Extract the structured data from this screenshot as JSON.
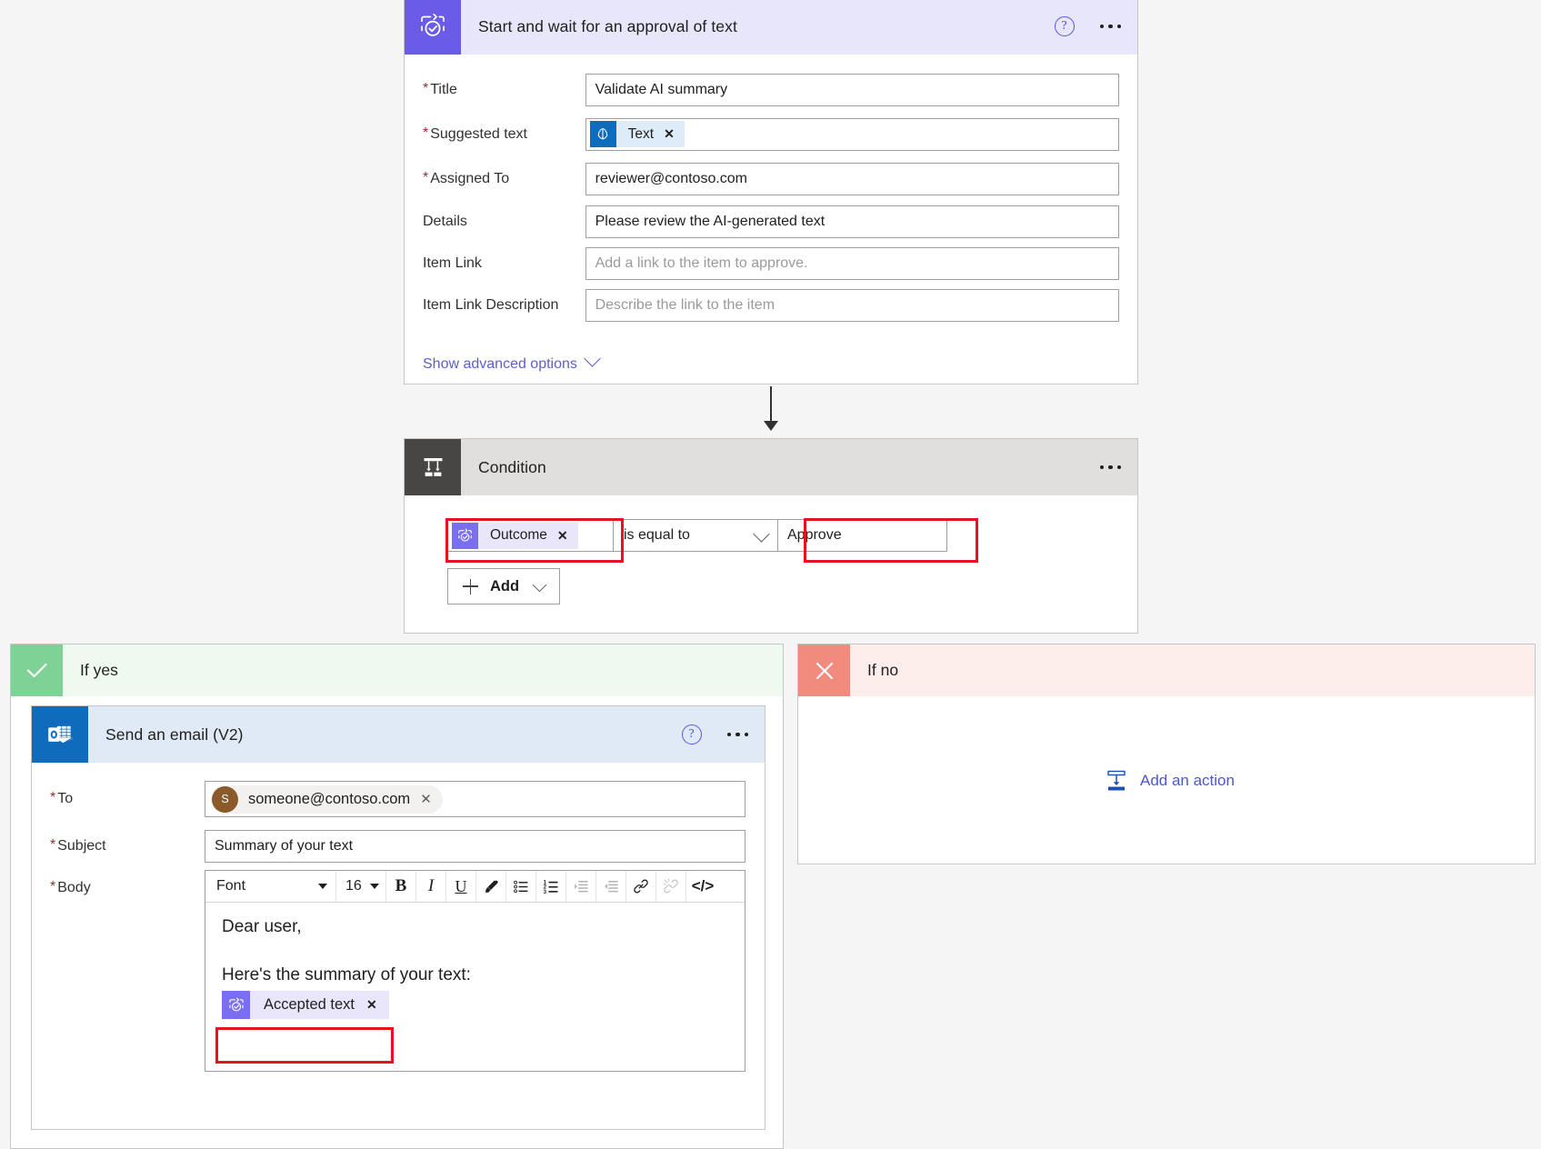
{
  "approval_card": {
    "title": "Start and wait for an approval of text",
    "icon": "approvals-icon",
    "help_label": "?",
    "fields": [
      {
        "label": "Title",
        "required": true,
        "value": "Validate AI summary",
        "type": "text"
      },
      {
        "label": "Suggested text",
        "required": true,
        "token": "Text",
        "token_icon": "ai-builder-icon",
        "type": "token"
      },
      {
        "label": "Assigned To",
        "required": true,
        "value": "reviewer@contoso.com",
        "type": "text"
      },
      {
        "label": "Details",
        "required": false,
        "value": "Please review the AI-generated text",
        "type": "text"
      },
      {
        "label": "Item Link",
        "required": false,
        "placeholder": "Add a link to the item to approve.",
        "type": "text"
      },
      {
        "label": "Item Link Description",
        "required": false,
        "placeholder": "Describe the link to the item",
        "type": "text"
      }
    ],
    "advanced_link": "Show advanced options"
  },
  "condition_card": {
    "title": "Condition",
    "icon": "condition-icon",
    "left_token": "Outcome",
    "left_token_icon": "approvals-icon",
    "operator": "is equal to",
    "right_value": "Approve",
    "add_button": "Add"
  },
  "branch_yes": {
    "label": "If yes",
    "icon": "checkmark-icon"
  },
  "branch_no": {
    "label": "If no",
    "icon": "cross-icon",
    "add_action": "Add an action",
    "add_action_icon": "add-action-icon"
  },
  "email_card": {
    "title": "Send an email (V2)",
    "icon": "outlook-icon",
    "help_label": "?",
    "to": {
      "label": "To",
      "required": true,
      "recipient": "someone@contoso.com",
      "avatar_initial": "S"
    },
    "subject": {
      "label": "Subject",
      "required": true,
      "value": "Summary of your text"
    },
    "body": {
      "label": "Body",
      "required": true,
      "toolbar": {
        "font_name": "Font",
        "font_size": "16",
        "buttons": [
          {
            "name": "bold-icon",
            "glyph": "B"
          },
          {
            "name": "italic-icon",
            "glyph": "I"
          },
          {
            "name": "underline-icon",
            "glyph": "U"
          },
          {
            "name": "highlighter-icon",
            "glyph": ""
          },
          {
            "name": "bulleted-list-icon",
            "glyph": ""
          },
          {
            "name": "numbered-list-icon",
            "glyph": ""
          },
          {
            "name": "indent-icon",
            "glyph": ""
          },
          {
            "name": "outdent-icon",
            "glyph": ""
          },
          {
            "name": "link-icon",
            "glyph": ""
          },
          {
            "name": "unlink-icon",
            "glyph": ""
          },
          {
            "name": "code-view-icon",
            "glyph": "</>"
          }
        ]
      },
      "lines": [
        "Dear user,",
        "Here's the summary of your text:"
      ],
      "token": "Accepted text",
      "token_icon": "approvals-icon"
    }
  },
  "colors": {
    "approval_purple": "#6b5ce7",
    "approval_header_bg": "#e8e6fb",
    "condition_header_bg": "#e1dfdd",
    "condition_icon_bg": "#484644",
    "outlook_blue": "#0f6cbd",
    "email_header_bg": "#dfeaf6",
    "yes_green": "#7fd295",
    "yes_header_bg": "#eef9f0",
    "no_red": "#f08b7e",
    "no_header_bg": "#fdeeec",
    "highlight_red": "#e81123",
    "link_blue": "#5b5fc7",
    "required_red": "#a4262c"
  }
}
